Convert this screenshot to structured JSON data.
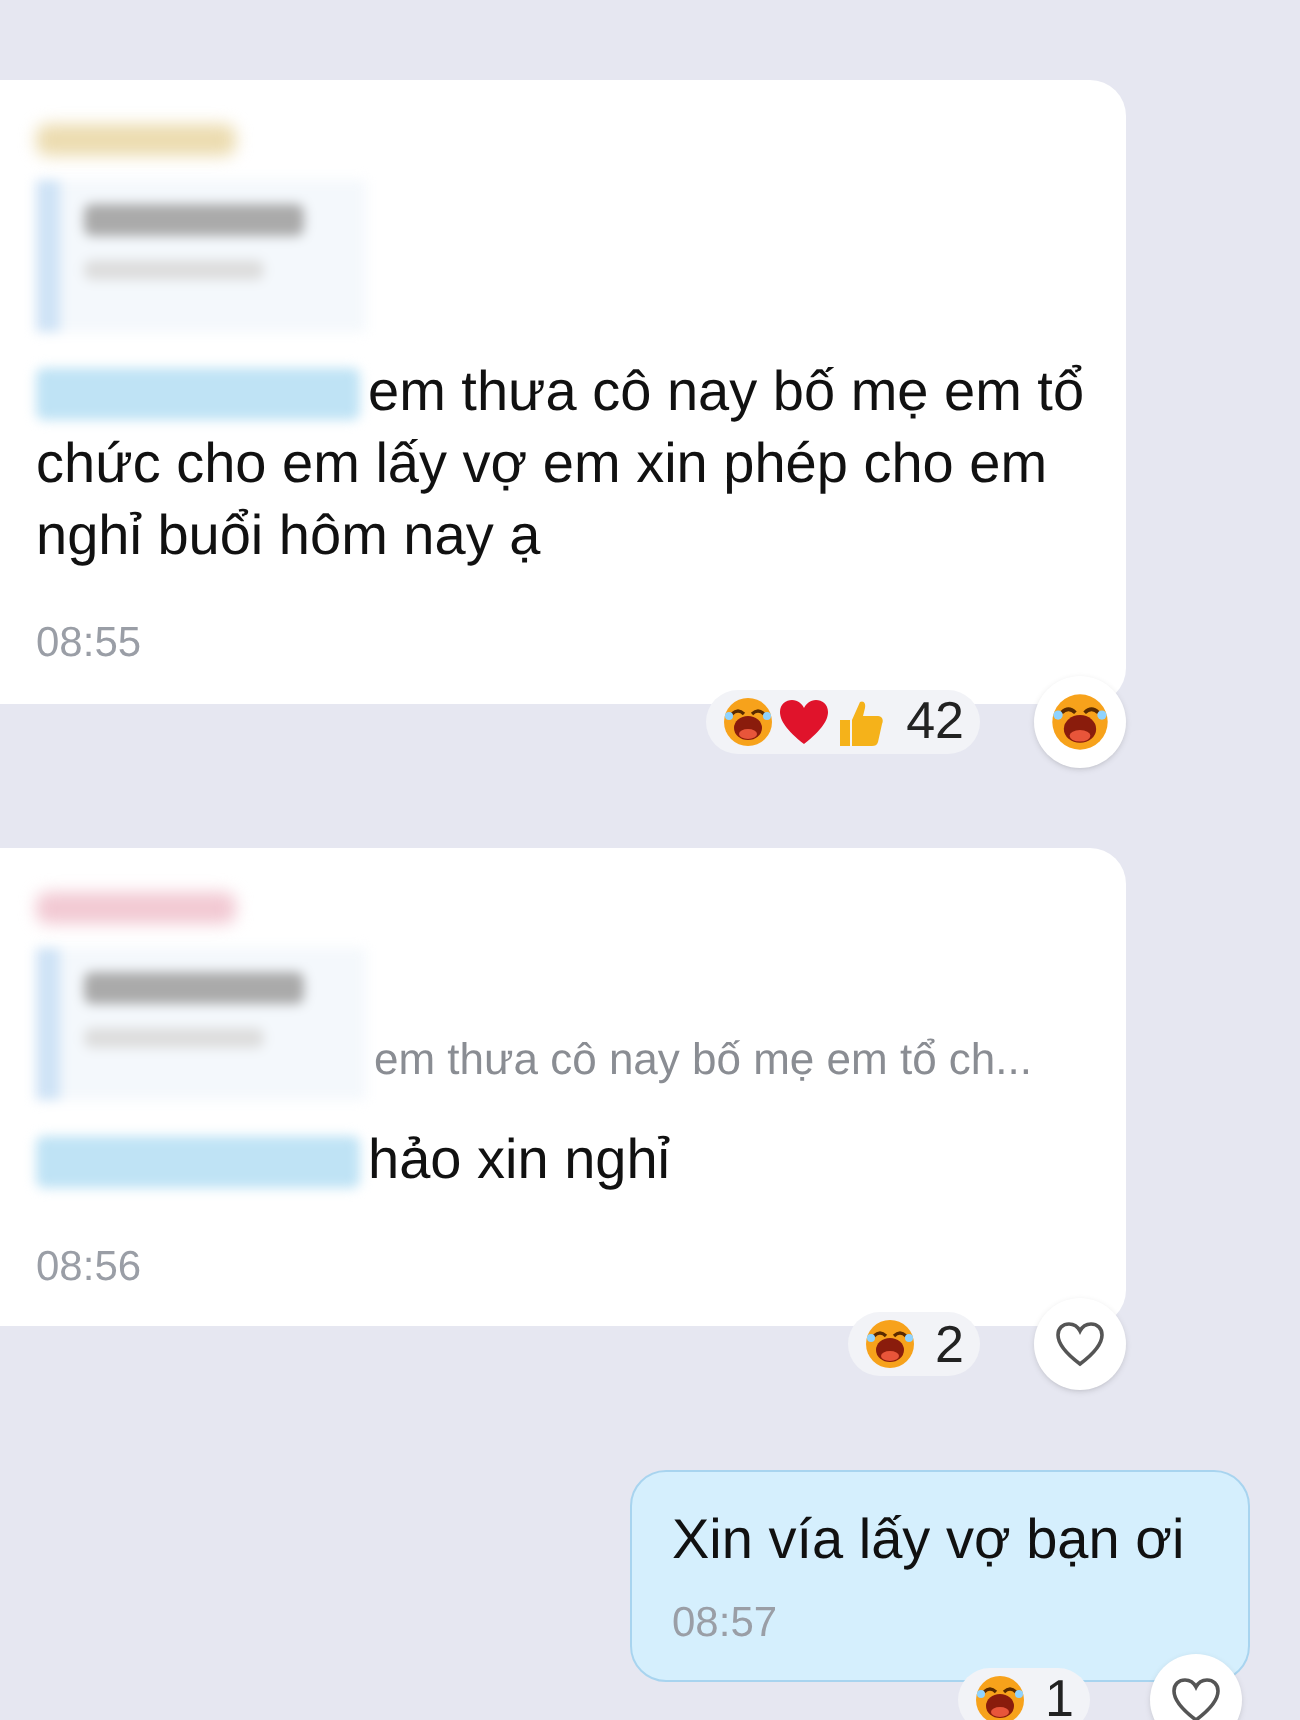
{
  "messages": [
    {
      "kind": "incoming",
      "has_quote": true,
      "mention": true,
      "text": "em thưa cô nay bố mẹ em tổ chức cho em lấy vợ em xin phép cho em nghỉ buổi hôm nay ạ",
      "time": "08:55",
      "reactions": {
        "emojis": [
          {
            "kind": "laugh"
          },
          {
            "kind": "heart"
          },
          {
            "kind": "like"
          }
        ],
        "count": "42"
      },
      "reacted": true
    },
    {
      "kind": "incoming",
      "has_quote": true,
      "quote_text": "em thưa cô nay bố mẹ em tổ ch...",
      "mention": true,
      "text": "hảo xin nghỉ",
      "time": "08:56",
      "reactions": {
        "emojis": [
          {
            "kind": "laugh"
          }
        ],
        "count": "2"
      },
      "reacted": false
    },
    {
      "kind": "outgoing",
      "has_quote": false,
      "mention": false,
      "text": "Xin vía lấy vợ bạn ơi",
      "time": "08:57",
      "reactions": {
        "emojis": [
          {
            "kind": "laugh"
          }
        ],
        "count": "1"
      },
      "reacted": false
    }
  ]
}
